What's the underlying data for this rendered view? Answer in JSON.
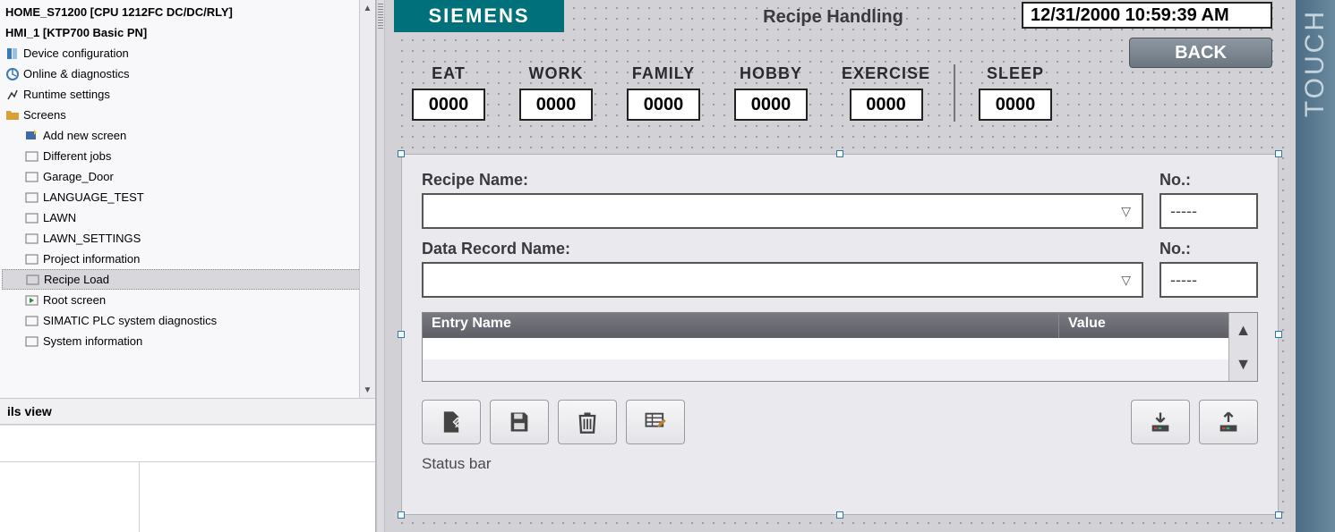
{
  "tree": {
    "plc_node": "HOME_S71200 [CPU 1212FC DC/DC/RLY]",
    "hmi_node": "HMI_1 [KTP700 Basic PN]",
    "device_config": "Device configuration",
    "online_diag": "Online & diagnostics",
    "runtime_settings": "Runtime settings",
    "screens_folder": "Screens",
    "add_new_screen": "Add new screen",
    "items": [
      "Different jobs",
      "Garage_Door",
      "LANGUAGE_TEST",
      "LAWN",
      "LAWN_SETTINGS",
      "Project information",
      "Recipe Load",
      "Root screen",
      "SIMATIC PLC system diagnostics",
      "System information"
    ],
    "selected_index": 6
  },
  "details_header": "ils view",
  "hmi": {
    "brand": "SIEMENS",
    "title": "Recipe Handling",
    "datetime": "12/31/2000 10:59:39 AM",
    "back_label": "BACK",
    "touch_label": "TOUCH"
  },
  "io_fields": {
    "eat": {
      "label": "EAT",
      "value": "0000"
    },
    "work": {
      "label": "WORK",
      "value": "0000"
    },
    "family": {
      "label": "FAMILY",
      "value": "0000"
    },
    "hobby": {
      "label": "HOBBY",
      "value": "0000"
    },
    "exercise": {
      "label": "EXERCISE",
      "value": "0000"
    },
    "sleep": {
      "label": "SLEEP",
      "value": "0000"
    }
  },
  "recipe_view": {
    "recipe_name_label": "Recipe Name:",
    "recipe_no_label": "No.:",
    "recipe_no_value": "-----",
    "record_name_label": "Data Record Name:",
    "record_no_label": "No.:",
    "record_no_value": "-----",
    "col_entry": "Entry Name",
    "col_value": "Value",
    "status_label": "Status bar"
  }
}
